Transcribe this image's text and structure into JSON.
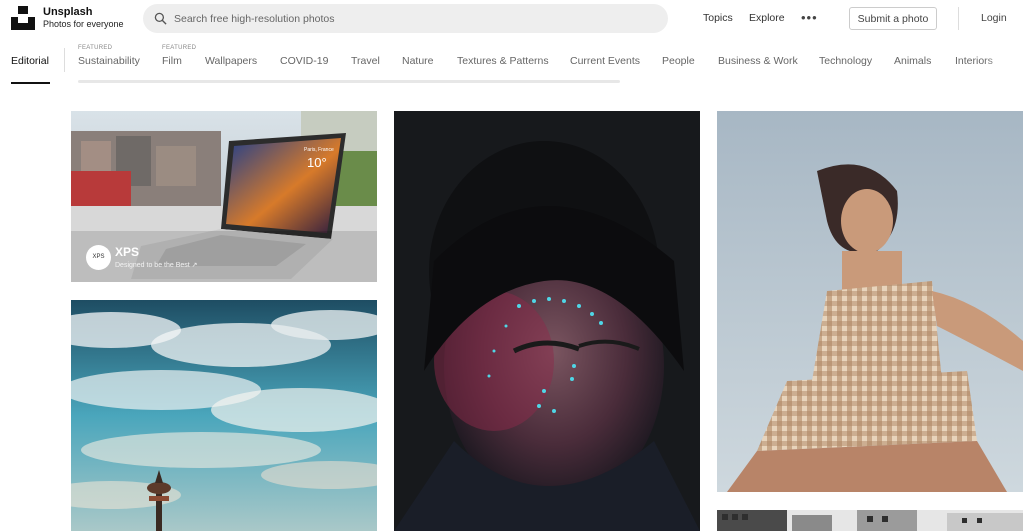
{
  "brand": {
    "name": "Unsplash",
    "tagline": "Photos for everyone"
  },
  "search": {
    "placeholder": "Search free high-resolution photos"
  },
  "nav": {
    "topics": "Topics",
    "explore": "Explore",
    "more": "•••",
    "submit": "Submit a photo",
    "login": "Login"
  },
  "topics": [
    {
      "label": "Editorial",
      "featured": "",
      "active": true
    },
    {
      "label": "Sustainability",
      "featured": "FEATURED"
    },
    {
      "label": "Film",
      "featured": "FEATURED"
    },
    {
      "label": "Wallpapers",
      "featured": ""
    },
    {
      "label": "COVID-19",
      "featured": ""
    },
    {
      "label": "Travel",
      "featured": ""
    },
    {
      "label": "Nature",
      "featured": ""
    },
    {
      "label": "Textures & Patterns",
      "featured": ""
    },
    {
      "label": "Current Events",
      "featured": ""
    },
    {
      "label": "People",
      "featured": ""
    },
    {
      "label": "Business & Work",
      "featured": ""
    },
    {
      "label": "Technology",
      "featured": ""
    },
    {
      "label": "Animals",
      "featured": ""
    },
    {
      "label": "Interiors",
      "featured": ""
    }
  ],
  "sponsored": {
    "brand": "XPS",
    "tagline": "Designed to be the Best ↗",
    "badge": "XPS",
    "screen_city": "Paris, France",
    "screen_temp": "10°"
  },
  "photos": [
    {
      "subject": "laptop-on-desk"
    },
    {
      "subject": "sky-tower"
    },
    {
      "subject": "woman-portrait-dots"
    },
    {
      "subject": "woman-low-angle"
    },
    {
      "subject": "buildings"
    }
  ],
  "colors": {
    "accent": "#111111",
    "search_bg": "#eeeeee",
    "muted_text": "#666666"
  }
}
